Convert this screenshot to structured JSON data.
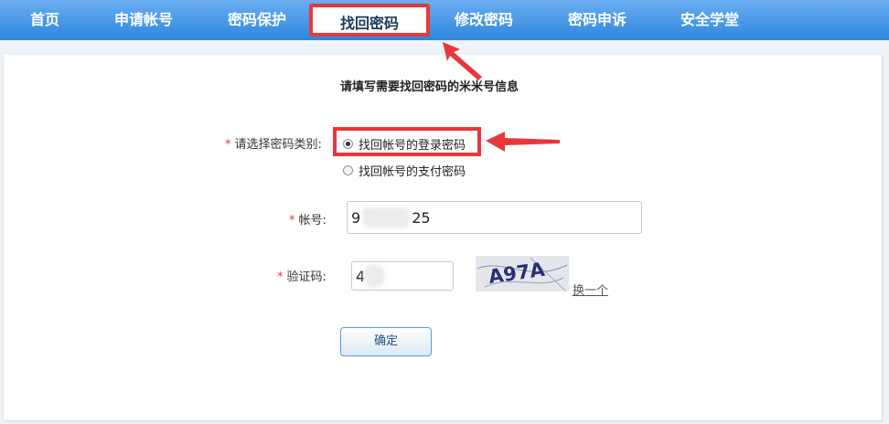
{
  "nav": {
    "items": [
      {
        "label": "首页"
      },
      {
        "label": "申请帐号"
      },
      {
        "label": "密码保护"
      },
      {
        "label": "找回密码"
      },
      {
        "label": "修改密码"
      },
      {
        "label": "密码申诉"
      },
      {
        "label": "安全学堂"
      }
    ],
    "active_index": 3
  },
  "form": {
    "heading": "请填写需要找回密码的米米号信息",
    "required_mark": "*",
    "password_type": {
      "label": "请选择密码类别:",
      "options": [
        {
          "label": "找回帐号的登录密码",
          "checked": true
        },
        {
          "label": "找回帐号的支付密码",
          "checked": false
        }
      ]
    },
    "account": {
      "label": "帐号:",
      "value_prefix": "9",
      "value_suffix": "25"
    },
    "captcha": {
      "label": "验证码:",
      "value": "4",
      "image_text": "A97A",
      "refresh_label": "换一个"
    },
    "submit_label": "确定"
  },
  "colors": {
    "nav_top": "#6aaef0",
    "nav_bottom": "#2f86de",
    "highlight_red": "#e8373b",
    "required_red": "#e23a3a"
  }
}
